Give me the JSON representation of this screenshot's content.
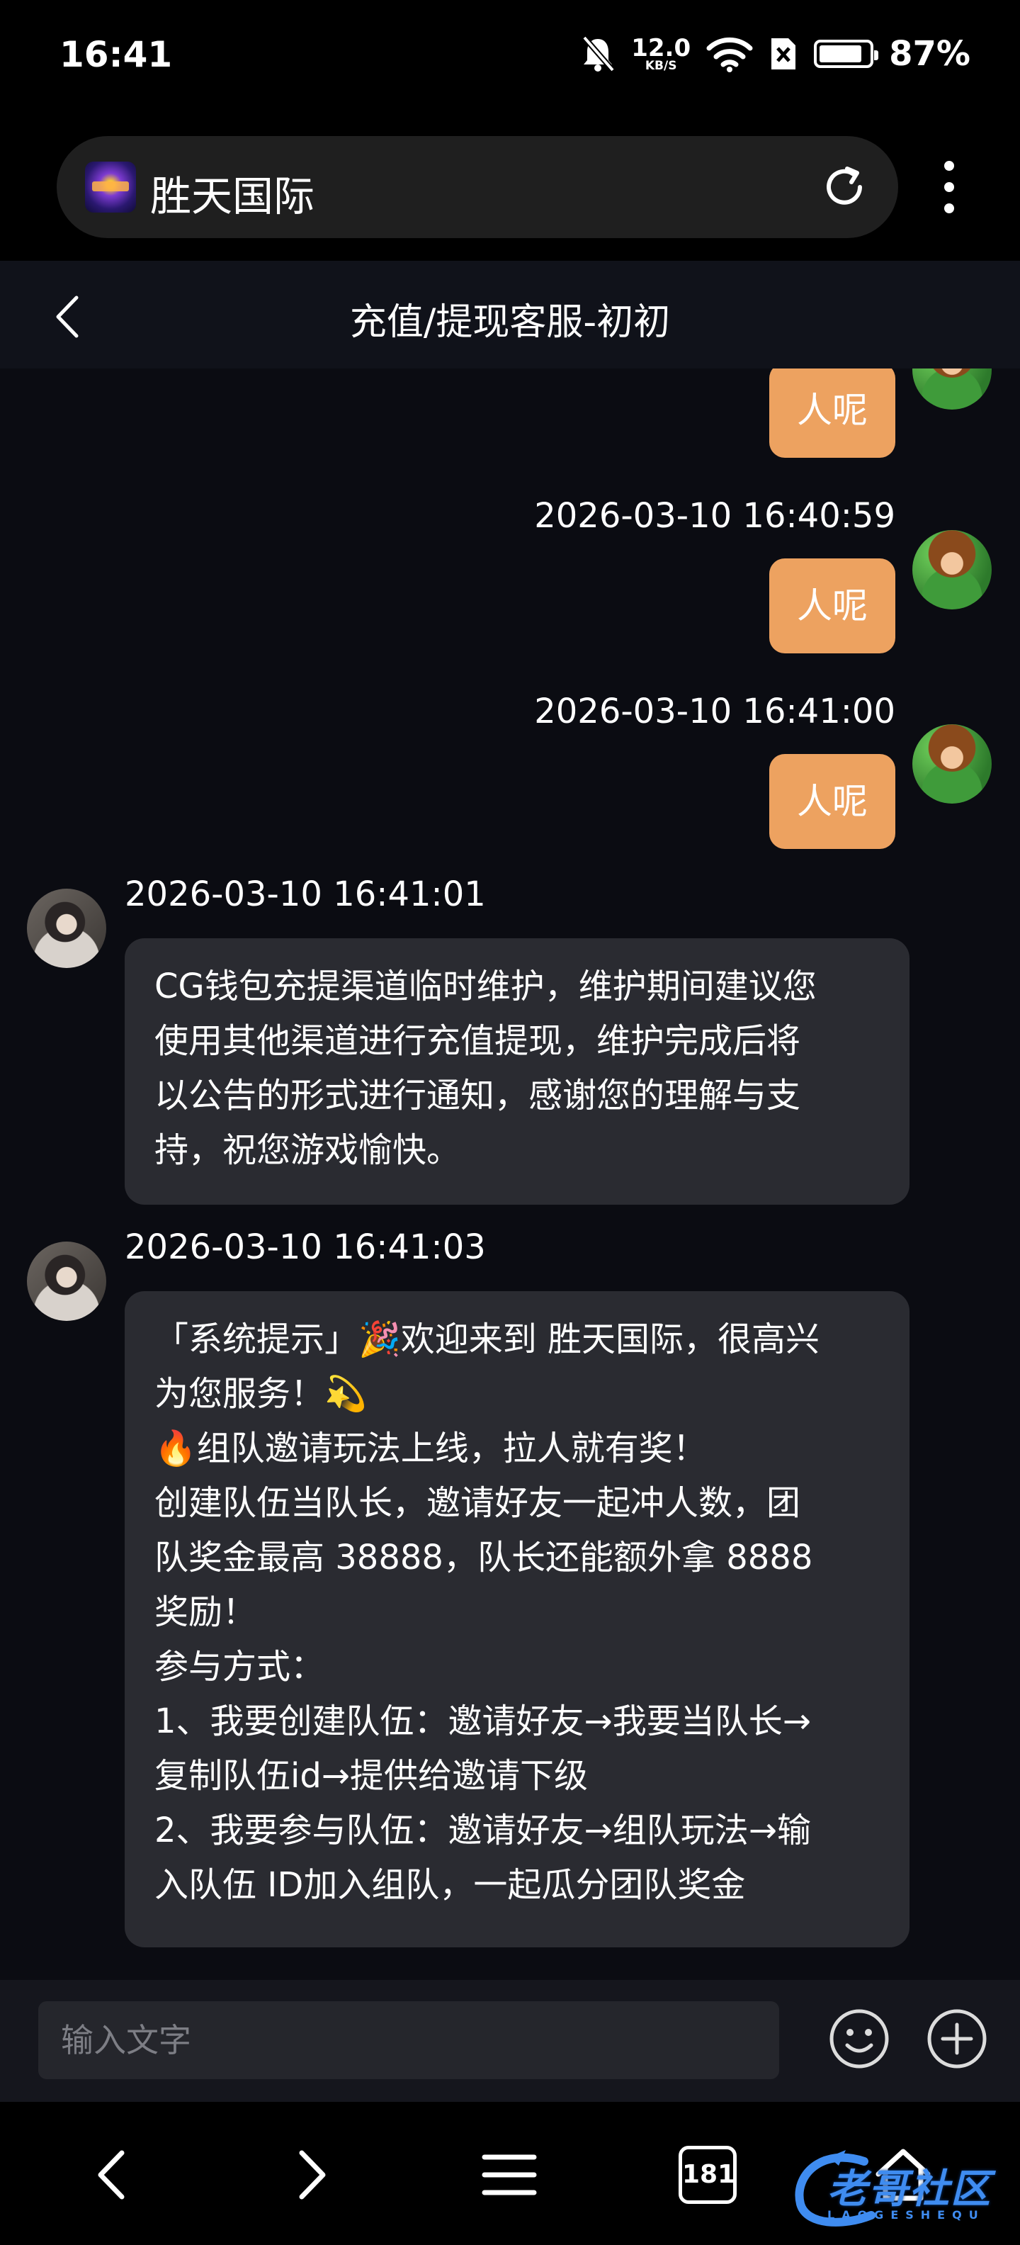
{
  "status_bar": {
    "time": "16:41",
    "net_speed_value": "12.0",
    "net_speed_unit": "KB/S",
    "battery_text": "87%",
    "battery_level": 0.87,
    "icons": [
      "mute-bell-icon",
      "network-speed",
      "wifi-icon",
      "sim-disabled-icon",
      "battery-icon"
    ]
  },
  "browser": {
    "site_title": "胜天国际",
    "tab_count": "181",
    "refresh_icon": "refresh-icon",
    "menu_icon": "more-vertical-icon"
  },
  "chat": {
    "title": "充值/提现客服-初初",
    "messages": [
      {
        "direction": "out",
        "time": "",
        "text": "人呢"
      },
      {
        "direction": "out",
        "time": "2026-03-10 16:40:59",
        "text": "人呢"
      },
      {
        "direction": "out",
        "time": "2026-03-10 16:41:00",
        "text": "人呢"
      },
      {
        "direction": "in",
        "time": "2026-03-10 16:41:01",
        "lines": [
          "CG钱包充提渠道临时维护，维护期间建议您",
          "使用其他渠道进行充值提现，维护完成后将",
          "以公告的形式进行通知，感谢您的理解与支",
          "持，祝您游戏愉快。"
        ]
      },
      {
        "direction": "in",
        "time": "2026-03-10 16:41:03",
        "lines": [
          "「系统提示」🎉欢迎来到 胜天国际，很高兴",
          "为您服务！💫",
          "🔥组队邀请玩法上线，拉人就有奖！",
          "创建队伍当队长，邀请好友一起冲人数，团",
          "队奖金最高 38888，队长还能额外拿 8888",
          "奖励！",
          "参与方式：",
          "1、我要创建队伍：邀请好友→我要当队长→",
          "复制队伍id→提供给邀请下级",
          "2、我要参与队伍：邀请好友→组队玩法→输",
          "入队伍 ID加入组队，一起瓜分团队奖金"
        ]
      }
    ]
  },
  "input": {
    "placeholder": "输入文字"
  },
  "watermark": {
    "text": "老哥社区",
    "sub": "LAOGESHEQU"
  },
  "colors": {
    "outgoing_bubble": "#eda260",
    "incoming_bubble": "#2a2b31",
    "chat_background": "#0b0c12",
    "watermark": "#3f8cf0"
  }
}
